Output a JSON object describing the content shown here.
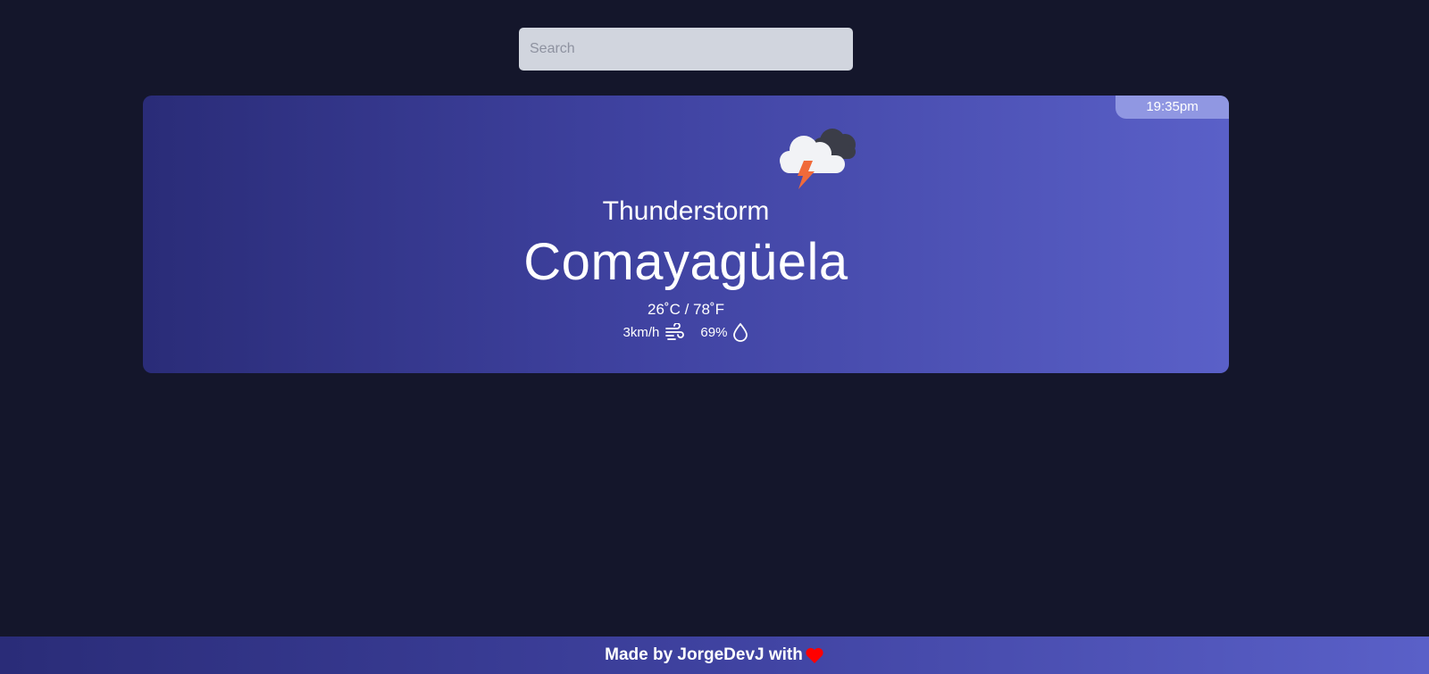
{
  "search": {
    "placeholder": "Search",
    "value": ""
  },
  "weather": {
    "time": "19:35pm",
    "icon": "thunderstorm-cloud-icon",
    "condition": "Thunderstorm",
    "city": "Comayagüela",
    "temperature": "26˚C / 78˚F",
    "wind": "3km/h",
    "wind_icon": "wind-icon",
    "humidity": "69%",
    "humidity_icon": "droplet-icon"
  },
  "footer": {
    "text": "Made by JorgeDevJ with",
    "icon": "heart-icon"
  },
  "colors": {
    "background": "#14162b",
    "card_gradient_start": "#2a2c78",
    "card_gradient_end": "#5a60c8",
    "time_badge": "#9097e2",
    "search_bg": "#d1d5de",
    "heart": "#ff0000",
    "bolt": "#f06a3a"
  }
}
